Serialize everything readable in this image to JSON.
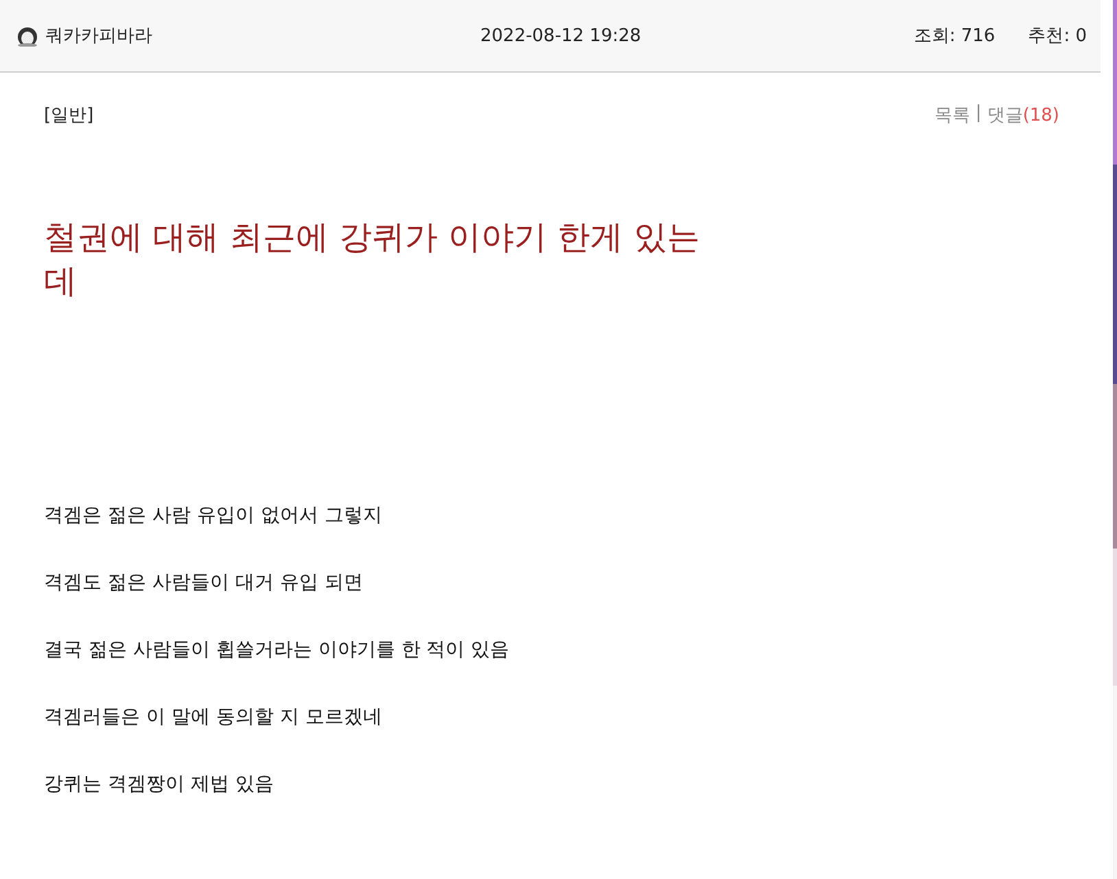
{
  "header": {
    "author": "쿼카카피바라",
    "datetime": "2022-08-12 19:28",
    "views": "조회: 716",
    "recommends": "추천: 0"
  },
  "category": "[일반]",
  "links": {
    "list": "목록",
    "separator": "|",
    "comments": "댓글",
    "comment_count": "(18)"
  },
  "title": "철권에 대해 최근에 강퀴가 이야기 한게 있는데",
  "body": [
    "격겜은 젊은 사람 유입이 없어서 그렇지",
    "격겜도 젊은 사람들이 대거 유입 되면",
    "결국 젊은 사람들이 휩쓸거라는 이야기를 한 적이 있음",
    "격겜러들은 이 말에 동의할 지 모르겠네",
    "강퀴는 격겜짱이 제법 있음"
  ]
}
